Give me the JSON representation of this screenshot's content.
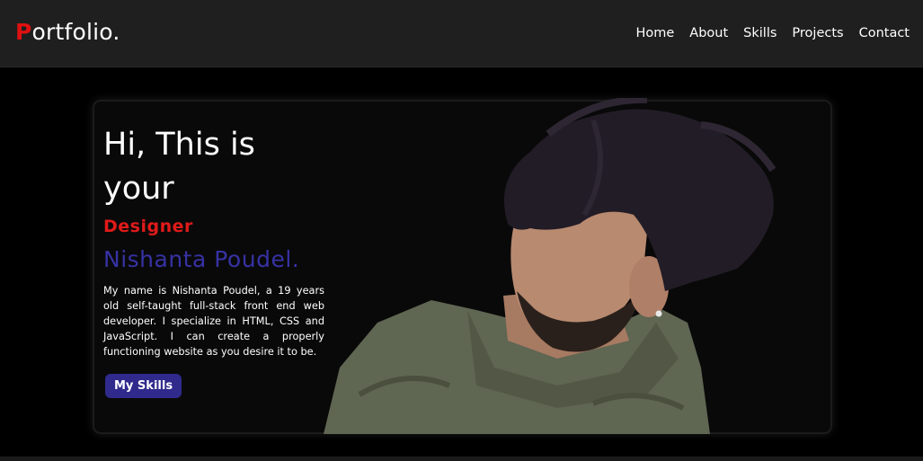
{
  "header": {
    "logo_first": "P",
    "logo_rest": "ortfolio.",
    "nav": [
      "Home",
      "About",
      "Skills",
      "Projects",
      "Contact"
    ]
  },
  "hero": {
    "greeting_line1": "Hi, This is",
    "greeting_line2": "your",
    "role": "Designer",
    "name": "Nishanta Poudel.",
    "bio": "My name is Nishanta Poudel, a 19 years old self-taught full-stack front end web developer. I specialize in HTML, CSS and JavaScript. I can create a properly functioning website as you desire it to be.",
    "button_label": "My Skills",
    "image": "portrait-photo"
  },
  "colors": {
    "accent_red": "#e01010",
    "accent_blue": "#3732a4",
    "button_bg": "#2f2a8c",
    "navbar_bg": "#1f1f1f",
    "page_bg": "#000000"
  }
}
